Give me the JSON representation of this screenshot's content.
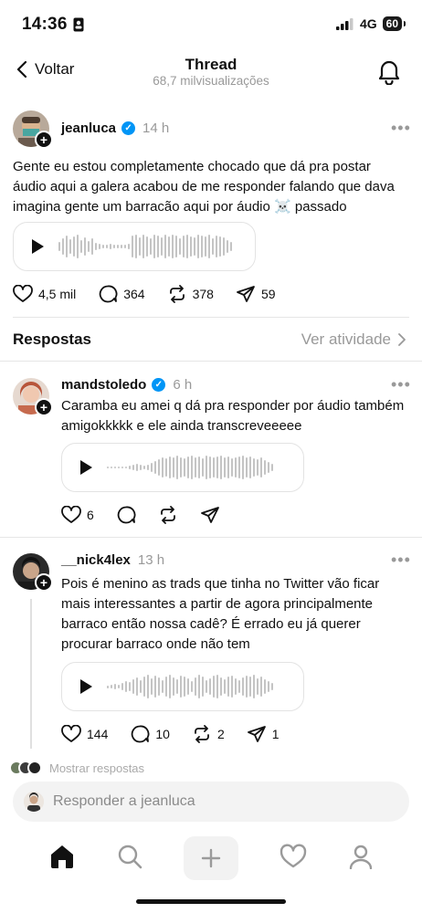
{
  "status": {
    "time": "14:36",
    "network": "4G",
    "battery": "60"
  },
  "header": {
    "back_label": "Voltar",
    "title": "Thread",
    "subtitle": "68,7 milvisualizações"
  },
  "main_post": {
    "username": "jeanluca",
    "time": "14 h",
    "text": "Gente eu estou completamente chocado que dá pra postar áudio aqui a galera acabou de me responder falando que dava imagina gente um barracão aqui por áudio ☠️ passado",
    "likes": "4,5 mil",
    "comments": "364",
    "reposts": "378",
    "shares": "59"
  },
  "replies_header": {
    "title": "Respostas",
    "activity_link": "Ver atividade"
  },
  "replies": [
    {
      "username": "mandstoledo",
      "time": "6 h",
      "text": "Caramba eu amei q dá pra responder por áudio também amigokkkkk e ele ainda transcreveeeee",
      "likes": "6",
      "comments": "",
      "reposts": "",
      "shares": ""
    },
    {
      "username": "__nick4lex",
      "time": "13 h",
      "text": "Pois é menino as trads que tinha no Twitter vão ficar mais interessantes a partir de agora principalmente barraco então nossa cadê? É errado eu já querer procurar barraco onde não tem",
      "likes": "144",
      "comments": "10",
      "reposts": "2",
      "shares": "1"
    }
  ],
  "more_replies_label": "Mostrar respostas",
  "composer": {
    "placeholder": "Responder a jeanluca"
  },
  "colors": {
    "verified": "#0095f6",
    "muted": "#999999",
    "text": "#101010"
  }
}
